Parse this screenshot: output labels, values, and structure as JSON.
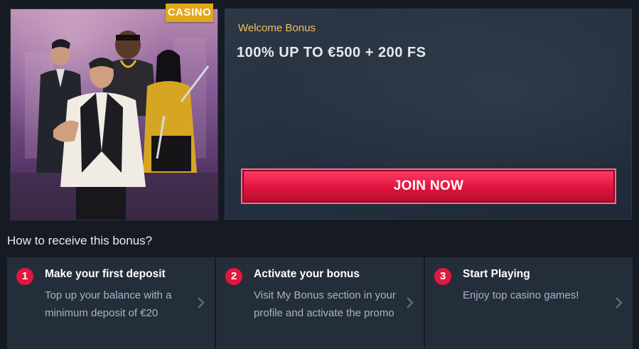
{
  "hero": {
    "badge": "CASINO",
    "image_alt": "casino-characters-artwork"
  },
  "promo": {
    "label": "Welcome Bonus",
    "title": "100% UP TO €500 + 200 FS",
    "button_label": "JOIN NOW"
  },
  "steps_section": {
    "title": "How to receive this bonus?",
    "steps": [
      {
        "number": "1",
        "title": "Make your first deposit",
        "description": "Top up your balance with a minimum deposit of €20"
      },
      {
        "number": "2",
        "title": "Activate your bonus",
        "description": "Visit My Bonus section in your profile and activate the promo"
      },
      {
        "number": "3",
        "title": "Start Playing",
        "description": "Enjoy top casino games!"
      }
    ]
  },
  "colors": {
    "background": "#151a23",
    "accent": "#e3173e",
    "badge": "#e2a81a",
    "promo_label": "#f2c25a"
  },
  "icons": {
    "step_arrow": "chevron-right-icon"
  }
}
